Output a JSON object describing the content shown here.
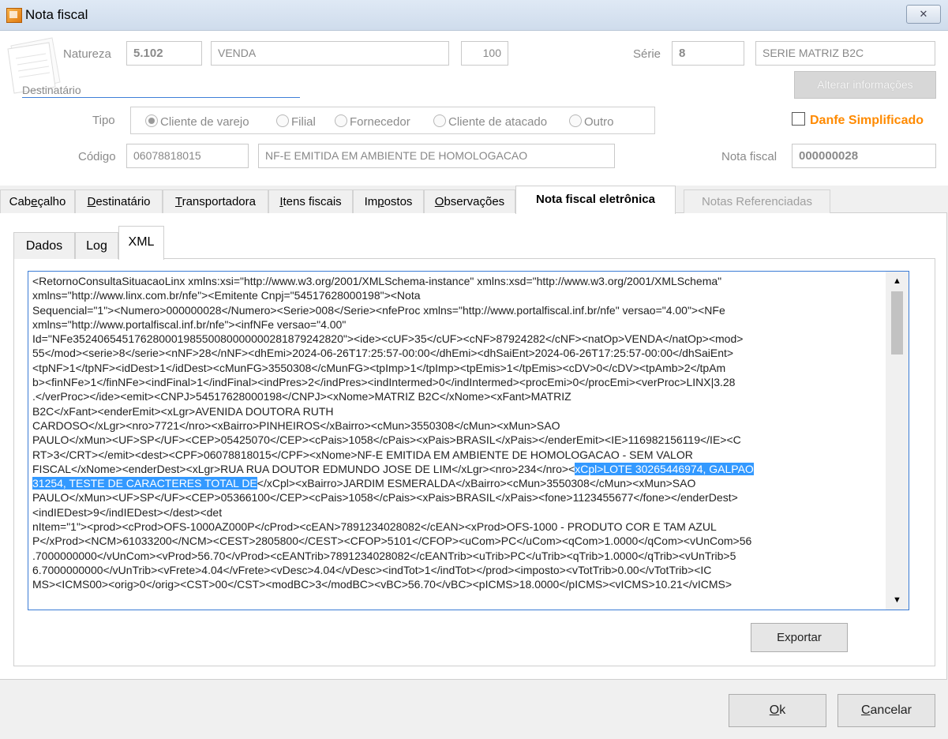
{
  "window": {
    "title": "Nota fiscal",
    "close_glyph": "✕"
  },
  "header": {
    "natureza_label": "Natureza",
    "natureza_code": "5.102",
    "natureza_desc": "VENDA",
    "natureza_num": "100",
    "serie_label": "Série",
    "serie_code": "8",
    "serie_desc": "SERIE MATRIZ B2C",
    "destinatario_label": "Destinatário",
    "alterar_button": "Alterar informações",
    "tipo_label": "Tipo",
    "tipo_options": [
      "Cliente de varejo",
      "Filial",
      "Fornecedor",
      "Cliente de atacado",
      "Outro"
    ],
    "tipo_selected": "Cliente de varejo",
    "danfe_label": "Danfe Simplificado",
    "danfe_checked": false,
    "codigo_label": "Código",
    "codigo_value": "06078818015",
    "codigo_name": "NF-E EMITIDA EM AMBIENTE DE HOMOLOGACAO",
    "nota_label": "Nota fiscal",
    "nota_value": "000000028"
  },
  "tabs": [
    {
      "pre": "Cab",
      "u": "e",
      "post": "çalho"
    },
    {
      "pre": "",
      "u": "D",
      "post": "estinatário"
    },
    {
      "pre": "",
      "u": "T",
      "post": "ransportadora"
    },
    {
      "pre": "",
      "u": "I",
      "post": "tens fiscais"
    },
    {
      "pre": "Im",
      "u": "p",
      "post": "ostos"
    },
    {
      "pre": "",
      "u": "O",
      "post": "bservações"
    },
    {
      "pre": "",
      "u": "",
      "post": "Nota fiscal eletrônica"
    },
    {
      "pre": "",
      "u": "",
      "post": "Notas Referenciadas"
    }
  ],
  "subtabs": [
    "Dados",
    "Log",
    "XML"
  ],
  "xml_lines": [
    "<RetornoConsultaSituacaoLinx xmlns:xsi=\"http://www.w3.org/2001/XMLSchema-instance\" xmlns:xsd=\"http://www.w3.org/2001/XMLSchema\"",
    "xmlns=\"http://www.linx.com.br/nfe\"><Emitente Cnpj=\"54517628000198\"><Nota",
    "Sequencial=\"1\"><Numero>000000028</Numero><Serie>008</Serie><nfeProc xmlns=\"http://www.portalfiscal.inf.br/nfe\" versao=\"4.00\"><NFe",
    "xmlns=\"http://www.portalfiscal.inf.br/nfe\"><infNFe versao=\"4.00\"",
    "Id=\"NFe35240654517628000198550080000000281879242820\"><ide><cUF>35</cUF><cNF>87924282</cNF><natOp>VENDA</natOp><mod>",
    "55</mod><serie>8</serie><nNF>28</nNF><dhEmi>2024-06-26T17:25:57-00:00</dhEmi><dhSaiEnt>2024-06-26T17:25:57-00:00</dhSaiEnt>",
    "<tpNF>1</tpNF><idDest>1</idDest><cMunFG>3550308</cMunFG><tpImp>1</tpImp><tpEmis>1</tpEmis><cDV>0</cDV><tpAmb>2</tpAm",
    "b><finNFe>1</finNFe><indFinal>1</indFinal><indPres>2</indPres><indIntermed>0</indIntermed><procEmi>0</procEmi><verProc>LINX|3.28",
    ".</verProc></ide><emit><CNPJ>54517628000198</CNPJ><xNome>MATRIZ B2C</xNome><xFant>MATRIZ",
    "B2C</xFant><enderEmit><xLgr>AVENIDA DOUTORA RUTH",
    "CARDOSO</xLgr><nro>7721</nro><xBairro>PINHEIROS</xBairro><cMun>3550308</cMun><xMun>SAO",
    "PAULO</xMun><UF>SP</UF><CEP>05425070</CEP><cPais>1058</cPais><xPais>BRASIL</xPais></enderEmit><IE>116982156119</IE><C",
    "RT>3</CRT></emit><dest><CPF>06078818015</CPF><xNome>NF-E EMITIDA EM AMBIENTE DE HOMOLOGACAO - SEM VALOR",
    "FISCAL</xNome><enderDest><xLgr>RUA RUA DOUTOR EDMUNDO JOSE DE LIM</xLgr><nro>234</nro><",
    "31254, TESTE DE CARACTERES TOTAL DE",
    "PAULO</xMun><UF>SP</UF><CEP>05366100</CEP><cPais>1058</cPais><xPais>BRASIL</xPais><fone>1123455677</fone></enderDest>",
    "<indIEDest>9</indIEDest></dest><det",
    "nItem=\"1\"><prod><cProd>OFS-1000AZ000P</cProd><cEAN>7891234028082</cEAN><xProd>OFS-1000 - PRODUTO COR E TAM AZUL",
    "P</xProd><NCM>61033200</NCM><CEST>2805800</CEST><CFOP>5101</CFOP><uCom>PC</uCom><qCom>1.0000</qCom><vUnCom>56",
    ".7000000000</vUnCom><vProd>56.70</vProd><cEANTrib>7891234028082</cEANTrib><uTrib>PC</uTrib><qTrib>1.0000</qTrib><vUnTrib>5",
    "6.7000000000</vUnTrib><vFrete>4.04</vFrete><vDesc>4.04</vDesc><indTot>1</indTot></prod><imposto><vTotTrib>0.00</vTotTrib><IC",
    "MS><ICMS00><orig>0</orig><CST>00</CST><modBC>3</modBC><vBC>56.70</vBC><pICMS>18.0000</pICMS><vICMS>10.21</vICMS>"
  ],
  "xml_sel_a": "xCpl>LOTE 30265446974, GALPAO",
  "xml_rest_b": "</xCpl><xBairro>JARDIM ESMERALDA</xBairro><cMun>3550308</cMun><xMun>SAO",
  "buttons": {
    "export": "Exportar",
    "ok_u": "O",
    "ok_rest": "k",
    "cancel_u": "C",
    "cancel_rest": "ancelar"
  },
  "scroll": {
    "up": "▲",
    "down": "▼"
  }
}
